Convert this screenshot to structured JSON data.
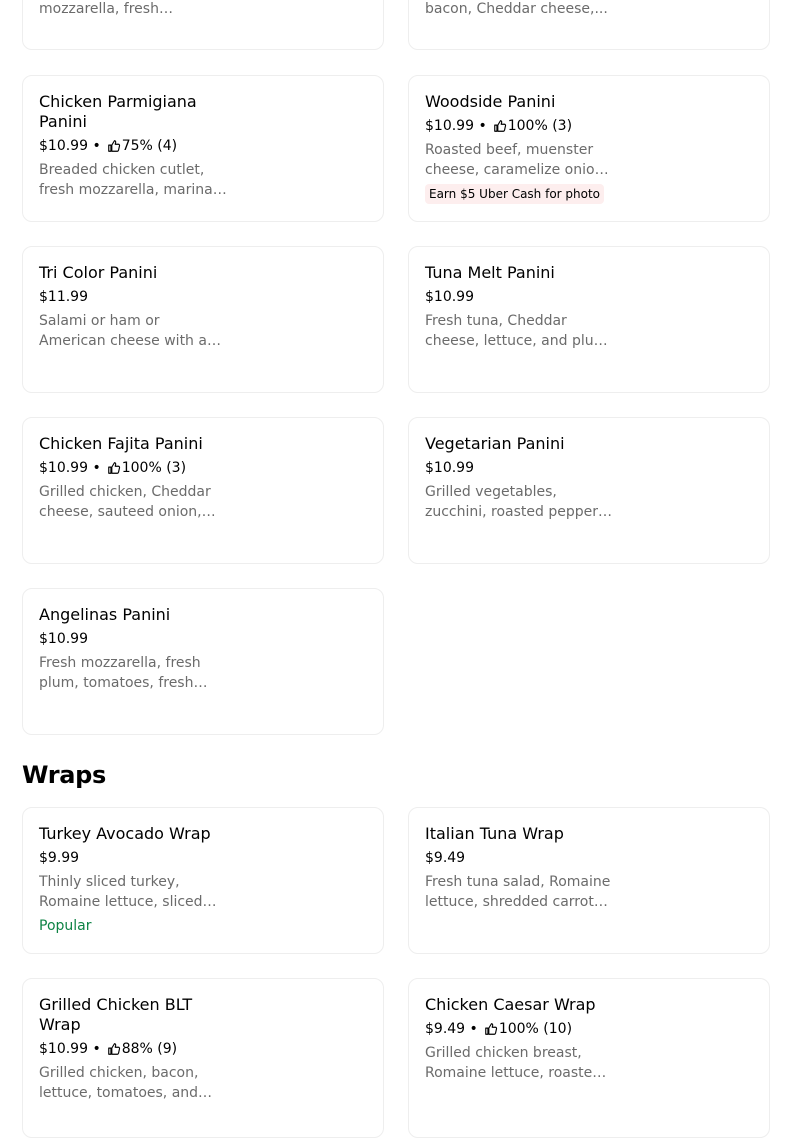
{
  "colors": {
    "popular": "#0e8345",
    "badge_bg": "#fdeeee",
    "desc": "#6b6b6b"
  },
  "partial_top": {
    "left_desc": "mozzarella, fresh cilantro,...",
    "right_desc": "bacon, Cheddar cheese,..."
  },
  "items": [
    {
      "title": "Chicken Parmigiana Panini",
      "price": "$10.99",
      "rating": "75% (4)",
      "desc": "Breaded chicken cutlet, fresh mozzarella, marinara sauce and fresh basil"
    },
    {
      "title": "Woodside Panini",
      "price": "$10.99",
      "rating": "100% (3)",
      "desc": "Roasted beef, muenster cheese, caramelize onion and horseradish sauce",
      "badge": "Earn $5 Uber Cash for photo"
    },
    {
      "title": "Tri Color Panini",
      "price": "$11.99",
      "desc": "Salami or ham or American cheese with a touch of pesto"
    },
    {
      "title": "Tuna Melt Panini",
      "price": "$10.99",
      "desc": "Fresh tuna, Cheddar cheese, lettuce, and plum tomato."
    },
    {
      "title": "Chicken Fajita Panini",
      "price": "$10.99",
      "rating": "100% (3)",
      "desc": "Grilled chicken, Cheddar cheese, sauteed onion, peppers"
    },
    {
      "title": "Vegetarian Panini",
      "price": "$10.99",
      "desc": "Grilled vegetables, zucchini, roasted peppers, and fresh mozzarella"
    },
    {
      "title": "Angelinas Panini",
      "price": "$10.99",
      "desc": "Fresh mozzarella, fresh plum, tomatoes, fresh basil and olive oil"
    }
  ],
  "section": {
    "title": "Wraps"
  },
  "wraps": [
    {
      "title": "Turkey Avocado Wrap",
      "price": "$9.99",
      "desc": "Thinly sliced turkey, Romaine lettuce, sliced avocado and tomato",
      "popular": "Popular"
    },
    {
      "title": "Italian Tuna Wrap",
      "price": "$9.49",
      "desc": "Fresh tuna salad, Romaine lettuce, shredded carrots, tomato"
    },
    {
      "title": "Grilled Chicken BLT Wrap",
      "price": "$10.99",
      "rating": "88% (9)",
      "desc": "Grilled chicken, bacon, lettuce, tomatoes, and mayo"
    },
    {
      "title": "Chicken Caesar Wrap",
      "price": "$9.49",
      "rating": "100% (10)",
      "desc": "Grilled chicken breast, Romaine lettuce, roasted peppers"
    }
  ]
}
